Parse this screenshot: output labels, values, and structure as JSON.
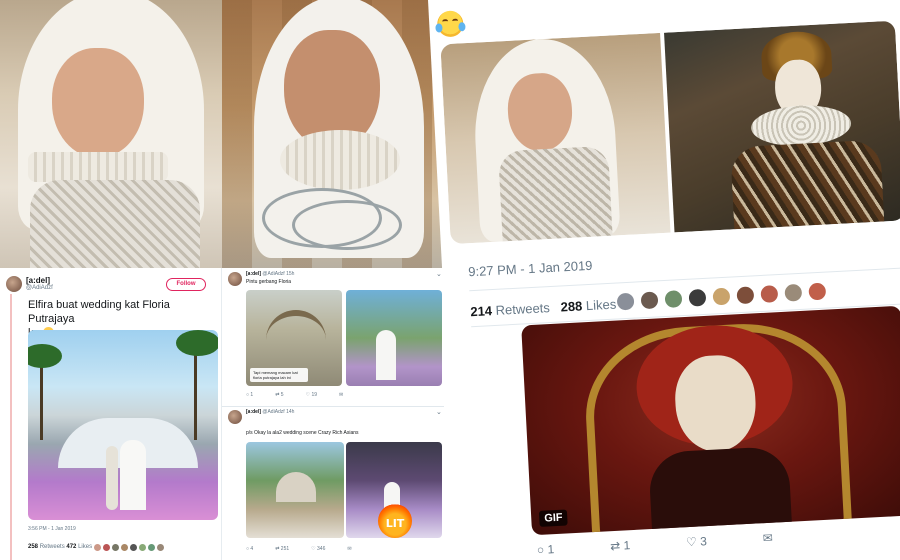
{
  "right_tweet": {
    "timestamp": "9:27 PM - 1 Jan 2019",
    "retweets_count": "214",
    "retweets_label": "Retweets",
    "likes_count": "288",
    "likes_label": "Likes",
    "gif_label": "GIF",
    "reply_count": "1",
    "retweet_count_small": "1",
    "like_count_small": "3",
    "avatar_colors": [
      "#8a8f99",
      "#6b5a4f",
      "#6f8f6a",
      "#3b3b3b",
      "#c9a36b",
      "#7d4e3a",
      "#b85c4a",
      "#9a8b79",
      "#c15f4a"
    ]
  },
  "left_tweet": {
    "user_name": "[a:del]",
    "handle": "@AdiAdzf",
    "follow_label": "Follow",
    "text_line1": "Elfira buat wedding kat Floria Putrajaya",
    "text_line2": "ke",
    "timestamp": "3:56 PM - 1 Jan 2019",
    "retweets_count": "258",
    "retweets_label": "Retweets",
    "likes_count": "472",
    "likes_label": "Likes"
  },
  "mid_tweet_1": {
    "user_name": "[a:del]",
    "handle": "@AdiAdzf",
    "time": "15h",
    "text": "Pintu gerbang Floria",
    "caption": "Tapi memang macam kat floria putrajaya lah ini",
    "reply_count": "1",
    "retweet_count": "5",
    "like_count": "19"
  },
  "mid_tweet_2": {
    "user_name": "[a:del]",
    "handle": "@AdiAdzf",
    "time": "14h",
    "text": "p/s Okay la ala2 wedding scene Crazy Rich Asians",
    "lit_label": "LIT",
    "reply_count": "4",
    "retweet_count": "251",
    "like_count": "346"
  }
}
